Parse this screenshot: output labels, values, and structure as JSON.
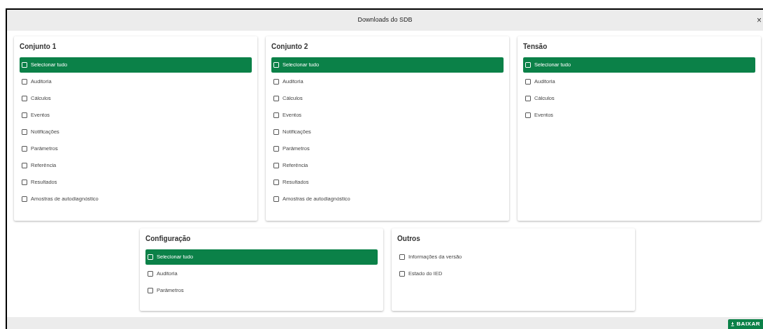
{
  "window": {
    "title": "Downloads do SDB",
    "close": "×"
  },
  "rows": [
    [
      {
        "title": "Conjunto 1",
        "items": [
          {
            "label": "Selecionar tudo",
            "checked": false,
            "selected": true
          },
          {
            "label": "Auditoria",
            "checked": false,
            "selected": false
          },
          {
            "label": "Cálculos",
            "checked": false,
            "selected": false
          },
          {
            "label": "Eventos",
            "checked": false,
            "selected": false
          },
          {
            "label": "Notificações",
            "checked": false,
            "selected": false
          },
          {
            "label": "Parâmetros",
            "checked": false,
            "selected": false
          },
          {
            "label": "Referência",
            "checked": false,
            "selected": false
          },
          {
            "label": "Resultados",
            "checked": false,
            "selected": false
          },
          {
            "label": "Amostras de autodiagnóstico",
            "checked": false,
            "selected": false
          }
        ]
      },
      {
        "title": "Conjunto 2",
        "items": [
          {
            "label": "Selecionar tudo",
            "checked": false,
            "selected": true
          },
          {
            "label": "Auditoria",
            "checked": false,
            "selected": false
          },
          {
            "label": "Cálculos",
            "checked": false,
            "selected": false
          },
          {
            "label": "Eventos",
            "checked": false,
            "selected": false
          },
          {
            "label": "Notificações",
            "checked": false,
            "selected": false
          },
          {
            "label": "Parâmetros",
            "checked": false,
            "selected": false
          },
          {
            "label": "Referência",
            "checked": false,
            "selected": false
          },
          {
            "label": "Resultados",
            "checked": false,
            "selected": false
          },
          {
            "label": "Amostras de autodiagnóstico",
            "checked": false,
            "selected": false
          }
        ]
      },
      {
        "title": "Tensão",
        "items": [
          {
            "label": "Selecionar tudo",
            "checked": false,
            "selected": true
          },
          {
            "label": "Auditoria",
            "checked": false,
            "selected": false
          },
          {
            "label": "Cálculos",
            "checked": false,
            "selected": false
          },
          {
            "label": "Eventos",
            "checked": false,
            "selected": false
          }
        ]
      }
    ],
    [
      {
        "title": "Configuração",
        "items": [
          {
            "label": "Selecionar tudo",
            "checked": false,
            "selected": true
          },
          {
            "label": "Auditoria",
            "checked": false,
            "selected": false
          },
          {
            "label": "Parâmetros",
            "checked": false,
            "selected": false
          }
        ]
      },
      {
        "title": "Outros",
        "items": [
          {
            "label": "Informações da versão",
            "checked": false,
            "selected": false
          },
          {
            "label": "Estado do IED",
            "checked": false,
            "selected": false
          }
        ]
      }
    ]
  ],
  "footer": {
    "button": "BAIXAR"
  }
}
